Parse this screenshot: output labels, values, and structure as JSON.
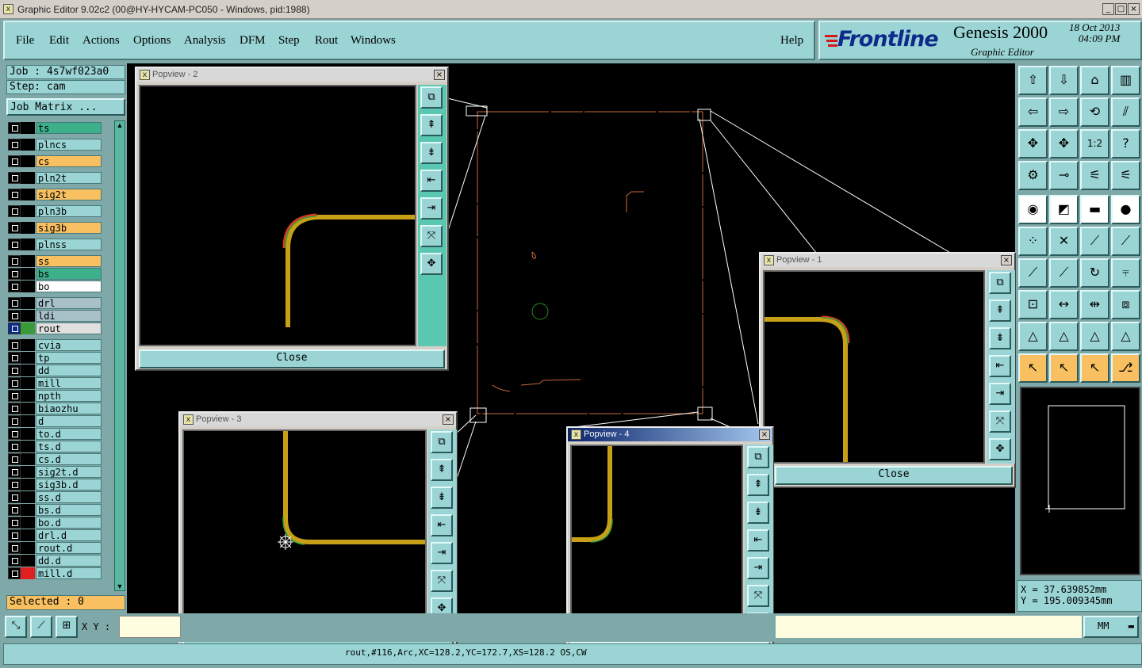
{
  "window": {
    "title": "Graphic Editor 9.02c2 (00@HY-HYCAM-PC050 - Windows, pid:1988)",
    "min": "_",
    "max": "□",
    "close": "×"
  },
  "menu": {
    "items": [
      "File",
      "Edit",
      "Actions",
      "Options",
      "Analysis",
      "DFM",
      "Step",
      "Rout",
      "Windows"
    ],
    "help": "Help"
  },
  "brand": {
    "logo": "Frontline",
    "product": "Genesis 2000",
    "subtitle": "Graphic Editor",
    "date": "18 Oct 2013",
    "time": "04:09 PM"
  },
  "job": {
    "job_label": "Job : 4s7wf023a0",
    "step_label": "Step: cam",
    "matrix_button": "Job Matrix ...",
    "selected": "Selected : 0"
  },
  "layers": [
    {
      "name": "ts",
      "color": "#3cb08a",
      "swatch": "#000"
    },
    {
      "name": "plncs",
      "color": "#9ad4d4",
      "swatch": "#000"
    },
    {
      "name": "cs",
      "color": "#f8c060",
      "swatch": "#000"
    },
    {
      "name": "pln2t",
      "color": "#9ad4d4",
      "swatch": "#000"
    },
    {
      "name": "sig2t",
      "color": "#f8c060",
      "swatch": "#000"
    },
    {
      "name": "pln3b",
      "color": "#9ad4d4",
      "swatch": "#000"
    },
    {
      "name": "sig3b",
      "color": "#f8c060",
      "swatch": "#000"
    },
    {
      "name": "plnss",
      "color": "#9ad4d4",
      "swatch": "#000"
    },
    {
      "name": "ss",
      "color": "#f8c060",
      "swatch": "#000"
    },
    {
      "name": "bs",
      "color": "#3cb08a",
      "swatch": "#000"
    },
    {
      "name": "bo",
      "color": "#ffffff",
      "swatch": "#000"
    },
    {
      "name": "drl",
      "color": "#a8c0c8",
      "swatch": "#000"
    },
    {
      "name": "ldi",
      "color": "#a8c0c8",
      "swatch": "#000"
    },
    {
      "name": "rout",
      "color": "#e0e0e0",
      "swatch": "#3a9a3a",
      "chk": "#0a2a8a"
    },
    {
      "name": "cvia",
      "color": "#9ad4d4",
      "swatch": "#000"
    },
    {
      "name": "tp",
      "color": "#9ad4d4",
      "swatch": "#000"
    },
    {
      "name": "dd",
      "color": "#9ad4d4",
      "swatch": "#000"
    },
    {
      "name": "mill",
      "color": "#9ad4d4",
      "swatch": "#000"
    },
    {
      "name": "npth",
      "color": "#9ad4d4",
      "swatch": "#000"
    },
    {
      "name": "biaozhu",
      "color": "#9ad4d4",
      "swatch": "#000"
    },
    {
      "name": "d",
      "color": "#9ad4d4",
      "swatch": "#000"
    },
    {
      "name": "to.d",
      "color": "#9ad4d4",
      "swatch": "#000"
    },
    {
      "name": "ts.d",
      "color": "#9ad4d4",
      "swatch": "#000"
    },
    {
      "name": "cs.d",
      "color": "#9ad4d4",
      "swatch": "#000"
    },
    {
      "name": "sig2t.d",
      "color": "#9ad4d4",
      "swatch": "#000"
    },
    {
      "name": "sig3b.d",
      "color": "#9ad4d4",
      "swatch": "#000"
    },
    {
      "name": "ss.d",
      "color": "#9ad4d4",
      "swatch": "#000"
    },
    {
      "name": "bs.d",
      "color": "#9ad4d4",
      "swatch": "#000"
    },
    {
      "name": "bo.d",
      "color": "#9ad4d4",
      "swatch": "#000"
    },
    {
      "name": "drl.d",
      "color": "#9ad4d4",
      "swatch": "#000"
    },
    {
      "name": "rout.d",
      "color": "#9ad4d4",
      "swatch": "#000"
    },
    {
      "name": "dd.d",
      "color": "#9ad4d4",
      "swatch": "#000"
    },
    {
      "name": "mill.d",
      "color": "#9ad4d4",
      "swatch": "#e02020"
    }
  ],
  "popviews": {
    "p2": "Popview - 2",
    "p1": "Popview - 1",
    "p3": "Popview - 3",
    "p4": "Popview - 4",
    "close": "Close",
    "x": "×"
  },
  "coords": {
    "x": "X = 37.639852mm",
    "y": "Y = 195.009345mm"
  },
  "bottom": {
    "xy_label": "X Y :",
    "units": "MM"
  },
  "status": "rout,#116,Arc,XC=128.2,YC=172.7,XS=128.2                                           OS,CW",
  "colors": {
    "panel": "#9ad4d4",
    "bg": "#7fa8a8",
    "trace": "#c8a018"
  }
}
